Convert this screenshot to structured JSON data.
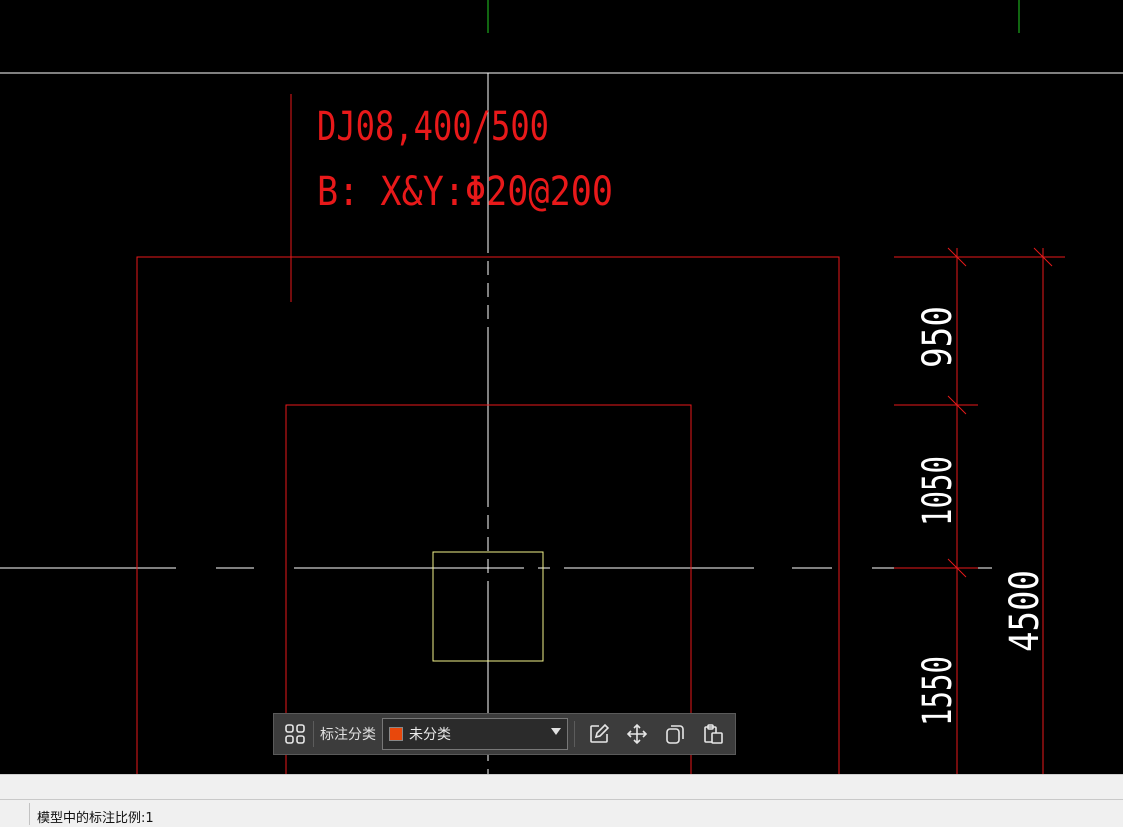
{
  "drawing": {
    "label_line1": "DJ08,400/500",
    "label_line2": "B: X&Y:Φ20@200",
    "dim_950": "950",
    "dim_1050": "1050",
    "dim_1550": "1550",
    "dim_4500": "4500",
    "colors": {
      "outline": "#e8191a",
      "column": "#f2f28a",
      "axis": "#ffffff",
      "grid_green": "#22cc22"
    }
  },
  "toolbar": {
    "grid_icon": "grid-icon",
    "category_label": "标注分类",
    "category_value": "未分类",
    "swatch_color": "#e8480c",
    "edit_icon": "edit-icon",
    "move_icon": "move-icon",
    "copy_icon": "copy-icon",
    "paste_icon": "paste-icon"
  },
  "status": {
    "scale_text": "模型中的标注比例:1"
  }
}
